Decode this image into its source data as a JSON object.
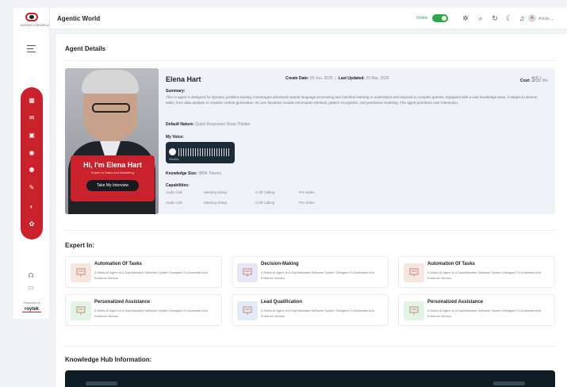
{
  "app": {
    "title": "Agentic World",
    "logo_text": "AGENTICWORLD"
  },
  "topbar": {
    "status_label": "Online",
    "status_on": true,
    "user_initial": "A",
    "user_name": "Ankita"
  },
  "sidebar": {
    "nav_icons": [
      "dashboard-icon",
      "chat-icon",
      "calendar-icon",
      "agent-icon",
      "users-icon",
      "edit-icon",
      "analytics-icon",
      "settings-icon"
    ],
    "bottom_icons": [
      "help-icon",
      "document-icon"
    ],
    "powered_by": "Powered by",
    "partner": "roytek"
  },
  "page": {
    "title": "Agent Details"
  },
  "agent": {
    "name": "Elena Hart",
    "create_label": "Create Date:",
    "create_date": "25 Jun, 2025",
    "updated_label": "Last Updated:",
    "updated_date": "23 Mar, 2025",
    "cost_label": "Cost:",
    "cost_value": "$5/",
    "cost_unit": "Mo",
    "summary_label": "Summary:",
    "summary": "This AI agent is designed for dynamic problem-solving. It leverages advanced natural language processing and machine learning to understand and respond to complex queries. Equipped with a vast knowledge base, it adapts to diverse tasks, from data analysis to creative content generation. Its core functions include information retrieval, pattern recognition, and predictive modeling. The agent prioritizes user interaction.",
    "default_nature_label": "Default Nature:",
    "default_nature": "Quick Response/ Deep Thinker",
    "voice_label": "My Voice:",
    "voice_time": "00m30s",
    "knowledge_label": "Knowledge Size:",
    "knowledge_value": "380K Tokens",
    "capabilities_label": "Capabilities:",
    "capabilities_row1": [
      "Audio Call",
      "Meeting Setup",
      "Cold Calling",
      "Pre Sales"
    ],
    "capabilities_row2": [
      "Audio Call",
      "Meeting Setup",
      "Cold Calling",
      "Pre Sales"
    ],
    "badge_title": "Hi, I'm Elena Hart",
    "badge_subtitle": "Expert in Sales And Marketing",
    "interview_button": "Take My Interview"
  },
  "expert": {
    "title": "Expert In:",
    "items": [
      {
        "title": "Automation Of Tasks",
        "desc": "A Sales AI Agent Is A Sophisticated Software System Designed To Automate And Enhance Various",
        "icon": "presentation-icon",
        "color": "#f7e6e0"
      },
      {
        "title": "Decision-Making",
        "desc": "A Sales AI Agent Is A Sophisticated Software System Designed To Automate And Enhance Various",
        "icon": "presentation-icon",
        "color": "#e6e6f7"
      },
      {
        "title": "Automation Of Tasks",
        "desc": "A Sales AI Agent Is A Sophisticated Software System Designed To Automate And Enhance Various",
        "icon": "presentation-icon",
        "color": "#f7e6e0"
      },
      {
        "title": "Personalized Assistance",
        "desc": "A Sales AI Agent Is A Sophisticated Software System Designed To Automate And Enhance Various",
        "icon": "presentation-icon",
        "color": "#e2f4e6"
      },
      {
        "title": "Lead Qualification",
        "desc": "A Sales AI Agent Is A Sophisticated Software System Designed To Automate And Enhance Various",
        "icon": "presentation-icon",
        "color": "#e2ecf7"
      },
      {
        "title": "Personalized Assistance",
        "desc": "A Sales AI Agent Is A Sophisticated Software System Designed To Automate And Enhance Various",
        "icon": "presentation-icon",
        "color": "#e2f4e6"
      }
    ]
  },
  "knowledge_hub": {
    "title": "Knowledge Hub Information:"
  }
}
